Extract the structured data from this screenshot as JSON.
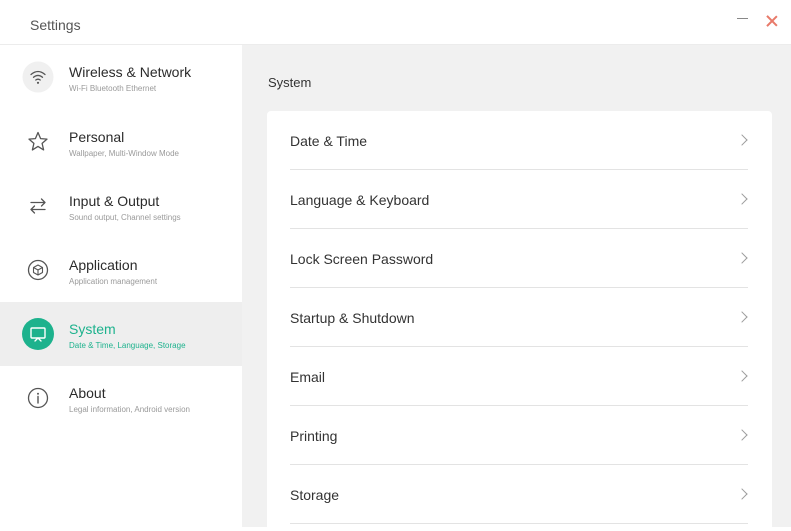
{
  "app": {
    "title": "Settings",
    "accent_color": "#1db28d",
    "close_color": "#e87a6a",
    "controls": {
      "minimize_icon": "minus-icon",
      "close_icon": "close-x-icon"
    }
  },
  "sidebar": {
    "items": [
      {
        "label": "Wireless & Network",
        "sub": "Wi-Fi Bluetooth Ethernet",
        "icon": "wifi-icon",
        "active": false
      },
      {
        "label": "Personal",
        "sub": "Wallpaper, Multi-Window Mode",
        "icon": "star-icon",
        "active": false
      },
      {
        "label": "Input & Output",
        "sub": "Sound output, Channel settings",
        "icon": "swap-arrows-icon",
        "active": false
      },
      {
        "label": "Application",
        "sub": "Application management",
        "icon": "cube-icon",
        "active": false
      },
      {
        "label": "System",
        "sub": "Date & Time, Language, Storage",
        "icon": "monitor-icon",
        "active": true
      },
      {
        "label": "About",
        "sub": "Legal information, Android version",
        "icon": "info-icon",
        "active": false
      }
    ]
  },
  "main": {
    "section_title": "System",
    "rows": [
      {
        "label": "Date & Time"
      },
      {
        "label": "Language & Keyboard"
      },
      {
        "label": "Lock Screen Password"
      },
      {
        "label": "Startup & Shutdown"
      },
      {
        "label": "Email"
      },
      {
        "label": "Printing"
      },
      {
        "label": "Storage"
      }
    ],
    "row_icon": "chevron-right-icon"
  }
}
